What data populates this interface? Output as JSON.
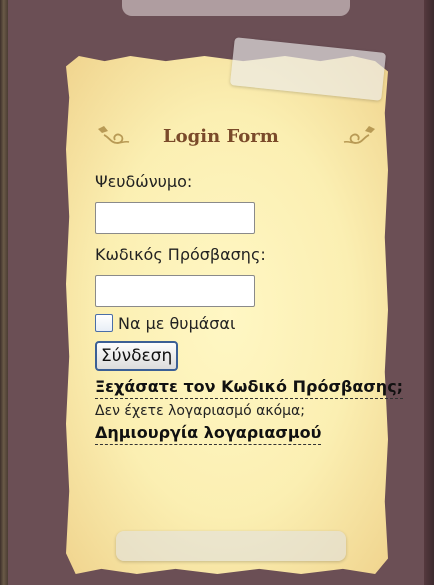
{
  "login_form": {
    "title": "Login Form",
    "username": {
      "label": "Ψευδώνυμο:",
      "value": ""
    },
    "password": {
      "label": "Κωδικός Πρόσβασης:",
      "value": ""
    },
    "remember_me": {
      "label": "Να με θυμάσαι",
      "checked": false
    },
    "submit_label": "Σύνδεση",
    "forgot_password_link": "Ξεχάσατε τον Κωδικό Πρόσβασης;",
    "no_account_text": "Δεν έχετε λογαριασμό ακόμα;",
    "create_account_link": "Δημιουργία λογαριασμού"
  },
  "colors": {
    "background": "#6b4f55",
    "paper": "#fbefb2",
    "title": "#7a4a2a",
    "button_border": "#3b5f95"
  }
}
